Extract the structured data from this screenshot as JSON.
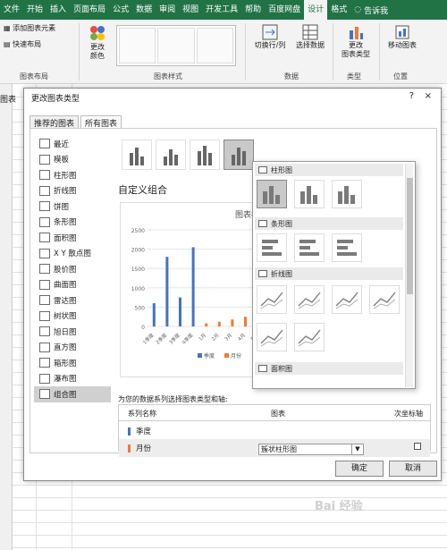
{
  "ribbon_tabs": [
    "文件",
    "开始",
    "插入",
    "页面布局",
    "公式",
    "数据",
    "审阅",
    "视图",
    "开发工具",
    "帮助",
    "百度网盘",
    "设计",
    "格式"
  ],
  "help_label": "告诉我",
  "ribbon": {
    "add_element": "添加图表元素",
    "quick_layout": "快速布局",
    "group_layout": "图表布局",
    "change_colors": "更改\n颜色",
    "group_styles": "图表样式",
    "switch_rowcol": "切换行/列",
    "select_data": "选择数据",
    "group_data": "数据",
    "change_type": "更改\n图表类型",
    "group_type": "类型",
    "move_chart": "移动图表",
    "group_location": "位置"
  },
  "sheet_label": "图表",
  "dialog": {
    "title": "更改图表类型",
    "help": "?",
    "close": "×",
    "tabs": [
      "推荐的图表",
      "所有图表"
    ],
    "active_tab": 1,
    "chart_types": [
      "最近",
      "模板",
      "柱形图",
      "折线图",
      "饼图",
      "条形图",
      "面积图",
      "X Y 散点图",
      "股价图",
      "曲面图",
      "雷达图",
      "树状图",
      "旭日图",
      "直方图",
      "箱形图",
      "瀑布图",
      "组合图"
    ],
    "selected_type": 16,
    "combo_title": "自定义组合",
    "preview_title": "图表标",
    "series_prompt": "为您的数据系列选择图表类型和轴:",
    "table_headers": [
      "系列名称",
      "图表",
      "次坐标轴"
    ],
    "series": [
      {
        "name": "季度",
        "color": "#4472c4"
      },
      {
        "name": "月份",
        "color": "#ed7d31",
        "chart_type": "簇状柱形图"
      }
    ],
    "ok": "确定",
    "cancel": "取消"
  },
  "popup": {
    "categories": [
      "柱形图",
      "条形图",
      "折线图",
      "面积图"
    ]
  },
  "watermark": "Bai 经验",
  "chart_data": {
    "type": "bar",
    "title": "图表标",
    "categories": [
      "1季度",
      "2季度",
      "3季度",
      "4季度",
      "1月",
      "2月",
      "3月",
      "4月",
      "5月",
      "6月"
    ],
    "series": [
      {
        "name": "季度",
        "values": [
          600,
          1800,
          750,
          2050,
          0,
          0,
          0,
          0,
          0,
          0
        ]
      },
      {
        "name": "月份",
        "values": [
          0,
          0,
          0,
          0,
          80,
          120,
          180,
          250,
          160,
          220
        ]
      }
    ],
    "ylim": [
      0,
      2500
    ],
    "yticks": [
      0,
      500,
      1000,
      1500,
      2000,
      2500
    ],
    "legend": "bottom"
  }
}
